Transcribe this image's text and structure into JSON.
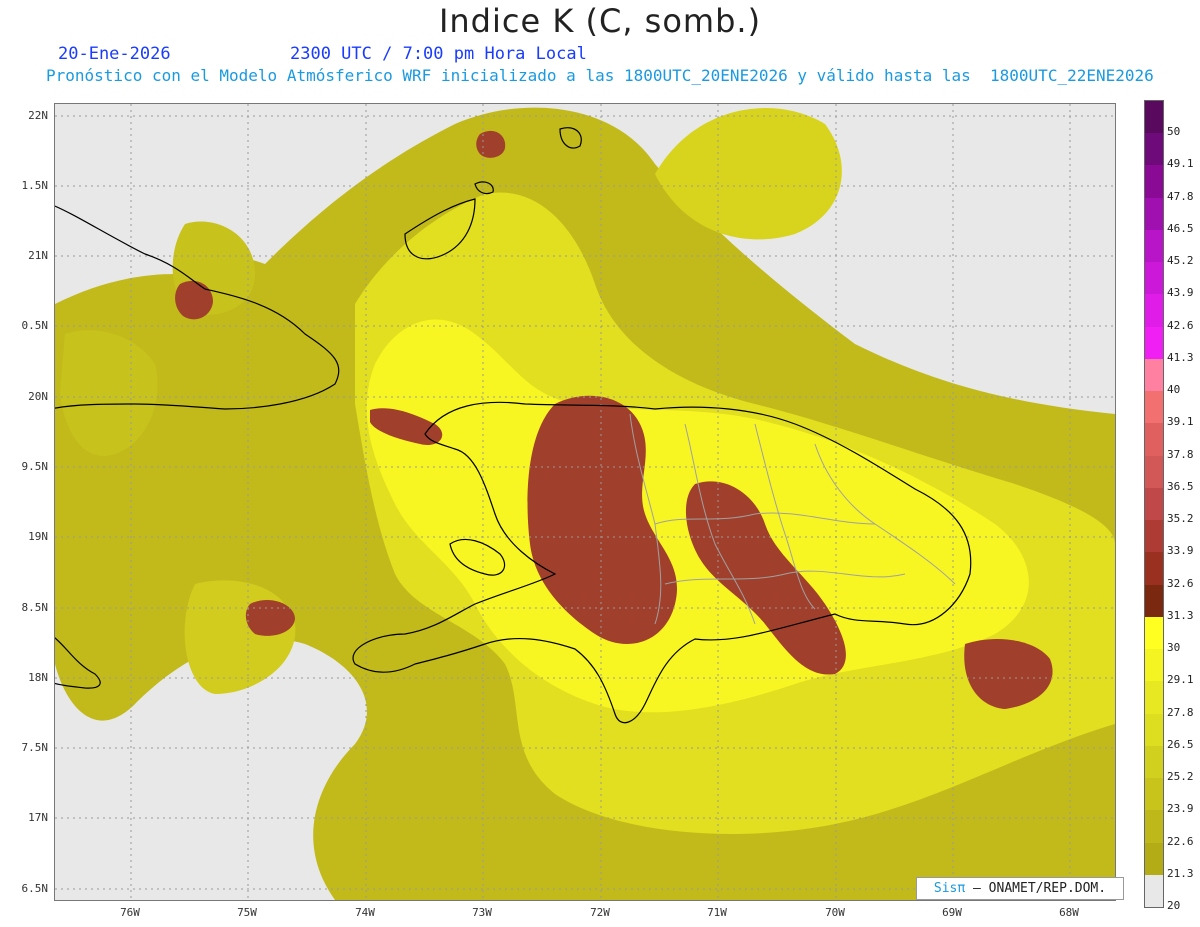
{
  "header": {
    "title": "Indice K (C, somb.)",
    "date": "20-Ene-2026",
    "time": "2300 UTC / 7:00 pm Hora Local",
    "model_line": "Pronóstico con el Modelo Atmósferico WRF inicializado a las 1800UTC_20ENE2026 y válido hasta las  1800UTC_22ENE2026"
  },
  "axes": {
    "lat_labels": [
      "22N",
      "1.5N",
      "21N",
      "0.5N",
      "20N",
      "9.5N",
      "19N",
      "8.5N",
      "18N",
      "7.5N",
      "17N",
      "6.5N"
    ],
    "lon_labels": [
      "76W",
      "75W",
      "74W",
      "73W",
      "72W",
      "71W",
      "70W",
      "69W",
      "68W"
    ]
  },
  "colorbar": {
    "labels": [
      "50",
      "49.1",
      "47.8",
      "46.5",
      "45.2",
      "43.9",
      "42.6",
      "41.3",
      "40",
      "39.1",
      "37.8",
      "36.5",
      "35.2",
      "33.9",
      "32.6",
      "31.3",
      "30",
      "29.1",
      "27.8",
      "26.5",
      "25.2",
      "23.9",
      "22.6",
      "21.3",
      "20"
    ],
    "colors": [
      "#5a0a5e",
      "#6e0a7a",
      "#8a0a96",
      "#a010b0",
      "#b814c8",
      "#cc18d8",
      "#e01ce8",
      "#f020f5",
      "#ff80a0",
      "#f27070",
      "#e06060",
      "#d25858",
      "#c04848",
      "#ae3c34",
      "#9a3020",
      "#7a2810",
      "#ffff22",
      "#f4f422",
      "#e8e822",
      "#dede20",
      "#d2d01e",
      "#c8c41c",
      "#beb81a",
      "#b4ac16",
      "#e8e8e8"
    ]
  },
  "legend_colors": {
    "unshaded": "#e8e8e8",
    "yellow_bright": "#ffff22",
    "yellow_mid": "#d2d01e",
    "olive": "#b4ac16",
    "brown": "#a0402c",
    "coast": "#000000",
    "provinces": "#a0a0a0"
  },
  "credit": {
    "brand": "Sisπ",
    "org": "– ONAMET/REP.DOM."
  }
}
